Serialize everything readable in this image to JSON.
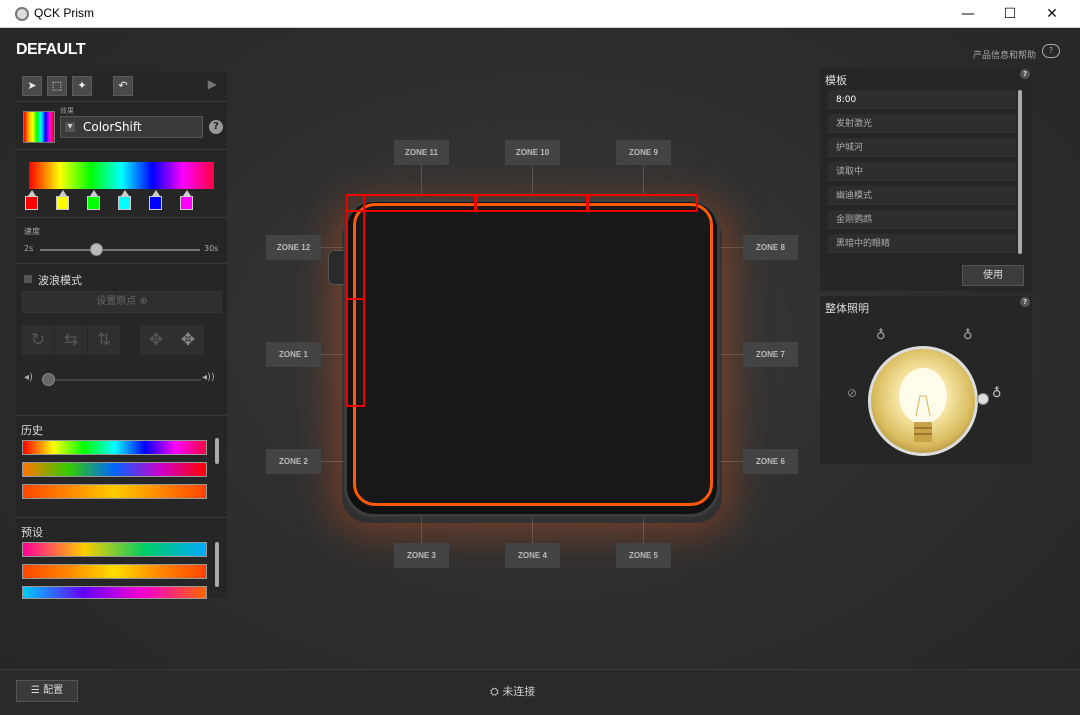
{
  "window": {
    "title": "QCK Prism",
    "minimize": "—",
    "maximize": "☐",
    "close": "✕"
  },
  "header": {
    "profile": "DEFAULT",
    "help_link": "产品信息和帮助"
  },
  "toolbar": {
    "select": "➤",
    "marquee": "⬚",
    "wand": "✦",
    "undo": "↶",
    "play": "▶"
  },
  "effect": {
    "small_label": "效果",
    "value": "ColorShift",
    "help": "?"
  },
  "gradient_stops": [
    "#ff0000",
    "#ffff00",
    "#00ff00",
    "#00ffff",
    "#0000ff",
    "#ff00ff"
  ],
  "speed": {
    "label": "速度",
    "min": "2s",
    "max": "30s",
    "value_fraction": 0.35
  },
  "wave": {
    "label": "波浪模式",
    "set_origin": "设置原点 ⊕"
  },
  "volume": {
    "low": "◂)",
    "high": "◂))"
  },
  "history": {
    "title": "历史"
  },
  "presets": {
    "title": "预设"
  },
  "zones": {
    "z1": "ZONE 1",
    "z2": "ZONE 2",
    "z3": "ZONE 3",
    "z4": "ZONE 4",
    "z5": "ZONE 5",
    "z6": "ZONE 6",
    "z7": "ZONE 7",
    "z8": "ZONE 8",
    "z9": "ZONE 9",
    "z10": "ZONE 10",
    "z11": "ZONE 11",
    "z12": "ZONE 12"
  },
  "templates": {
    "title": "模板",
    "help": "?",
    "items": [
      "8:00",
      "发射激光",
      "护城河",
      "读取中",
      "幽迪模式",
      "金刚鹦鹉",
      "黑暗中的眼睛"
    ],
    "use_button": "使用"
  },
  "lighting": {
    "title": "整体照明",
    "help": "?"
  },
  "bottom": {
    "config": "配置",
    "status": "未连接"
  },
  "colors": {
    "accent": "#ff5a0a",
    "selection": "#ee0000"
  }
}
